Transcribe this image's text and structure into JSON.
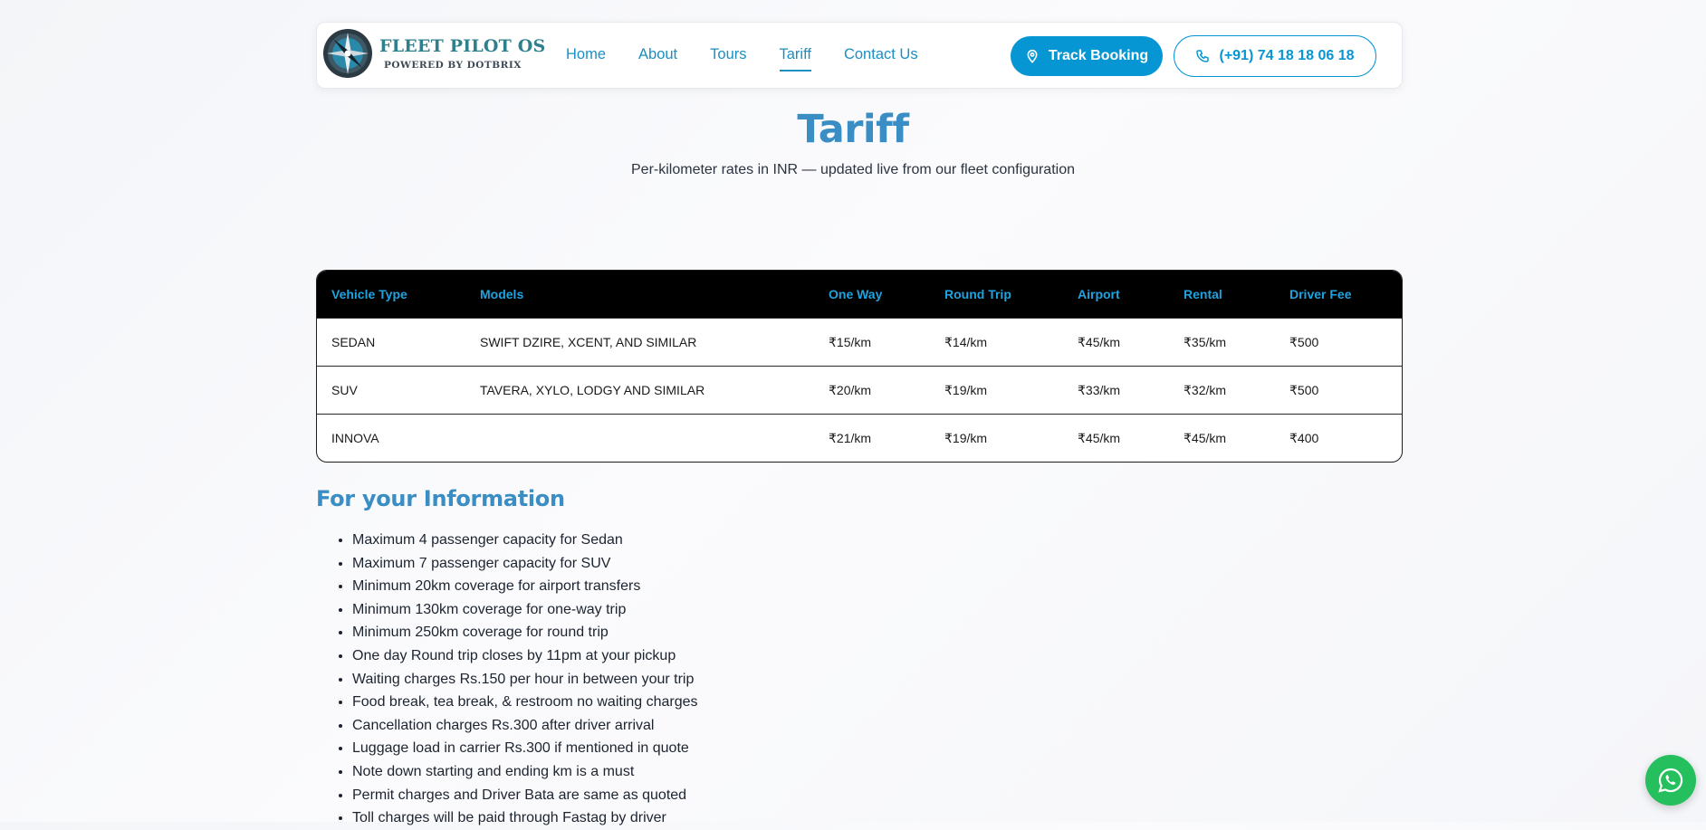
{
  "brand": {
    "title": "FLEET PILOT OS",
    "subtitle": "POWERED BY DOTBRIX",
    "accent": "#0796d4",
    "heading_color": "#3a8ec4"
  },
  "nav": {
    "links": [
      {
        "label": "Home",
        "active": false
      },
      {
        "label": "About",
        "active": false
      },
      {
        "label": "Tours",
        "active": false
      },
      {
        "label": "Tariff",
        "active": true
      },
      {
        "label": "Contact Us",
        "active": false
      }
    ],
    "track_label": "Track Booking",
    "track_icon": "map-pin-icon",
    "phone_label": "(+91) 74 18 18 06 18",
    "phone_icon": "phone-icon"
  },
  "page": {
    "title": "Tariff",
    "subtitle": "Per-kilometer rates in INR — updated live from our fleet configuration"
  },
  "table": {
    "headers": [
      "Vehicle Type",
      "Models",
      "One Way",
      "Round Trip",
      "Airport",
      "Rental",
      "Driver Fee"
    ],
    "rows": [
      [
        "SEDAN",
        "SWIFT DZIRE, XCENT, AND SIMILAR",
        "₹15/km",
        "₹14/km",
        "₹45/km",
        "₹35/km",
        "₹500"
      ],
      [
        "SUV",
        "TAVERA, XYLO, LODGY AND SIMILAR",
        "₹20/km",
        "₹19/km",
        "₹33/km",
        "₹32/km",
        "₹500"
      ],
      [
        "INNOVA",
        "",
        "₹21/km",
        "₹19/km",
        "₹45/km",
        "₹45/km",
        "₹400"
      ]
    ]
  },
  "info": {
    "title": "For your Information",
    "items": [
      "Maximum 4 passenger capacity for Sedan",
      "Maximum 7 passenger capacity for SUV",
      "Minimum 20km coverage for airport transfers",
      "Minimum 130km coverage for one-way trip",
      "Minimum 250km coverage for round trip",
      "One day Round trip closes by 11pm at your pickup",
      "Waiting charges Rs.150 per hour in between your trip",
      "Food break, tea break, & restroom no waiting charges",
      "Cancellation charges Rs.300 after driver arrival",
      "Luggage load in carrier Rs.300 if mentioned in quote",
      "Note down starting and ending km is a must",
      "Permit charges and Driver Bata are same as quoted",
      "Toll charges will be paid through Fastag by driver"
    ]
  },
  "whatsapp": {
    "icon": "whatsapp-icon",
    "color": "#25c05d"
  }
}
